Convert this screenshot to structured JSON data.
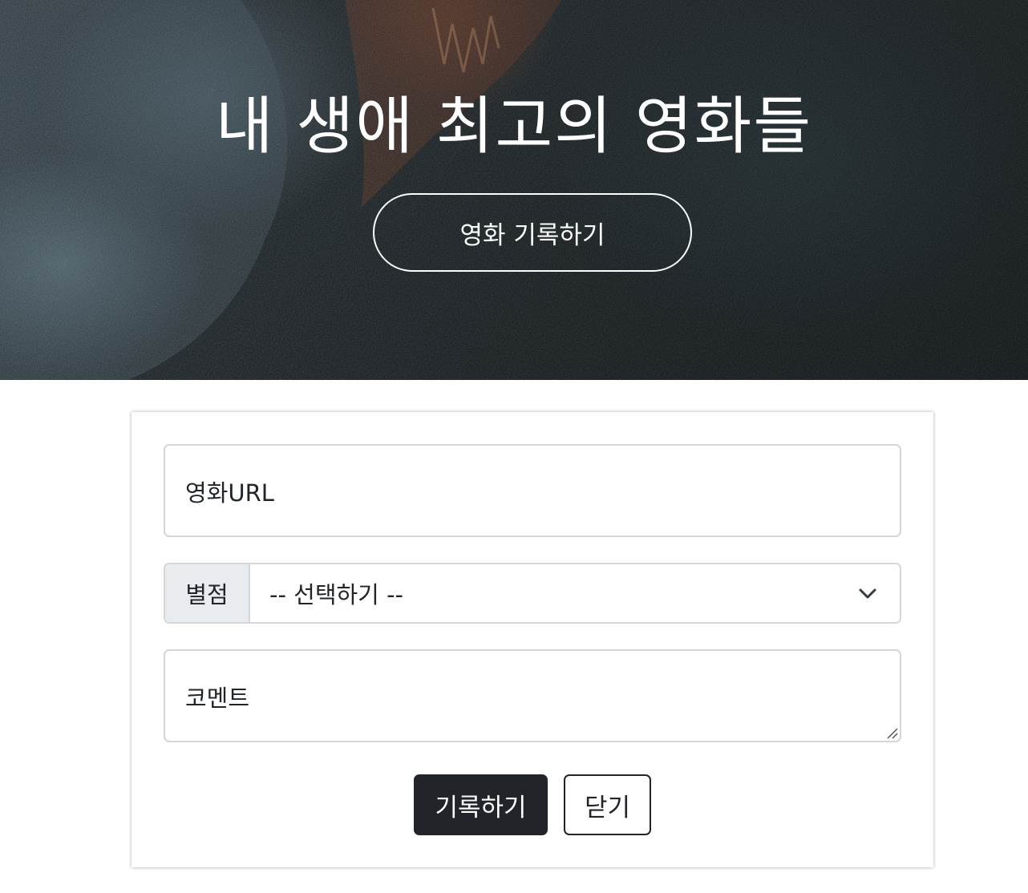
{
  "hero": {
    "title": "내 생애 최고의 영화들",
    "record_button_label": "영화 기록하기"
  },
  "form": {
    "url_label": "영화URL",
    "rating_label": "별점",
    "rating_selected": "-- 선택하기 --",
    "comment_label": "코멘트",
    "submit_label": "기록하기",
    "close_label": "닫기"
  },
  "icons": {
    "select_caret": "chevron-down-icon",
    "textarea_grip": "resize-grip-icon"
  },
  "colors": {
    "primary_button": "#212529",
    "input_border": "#d4d6d9",
    "label_background": "#e9ecef"
  }
}
